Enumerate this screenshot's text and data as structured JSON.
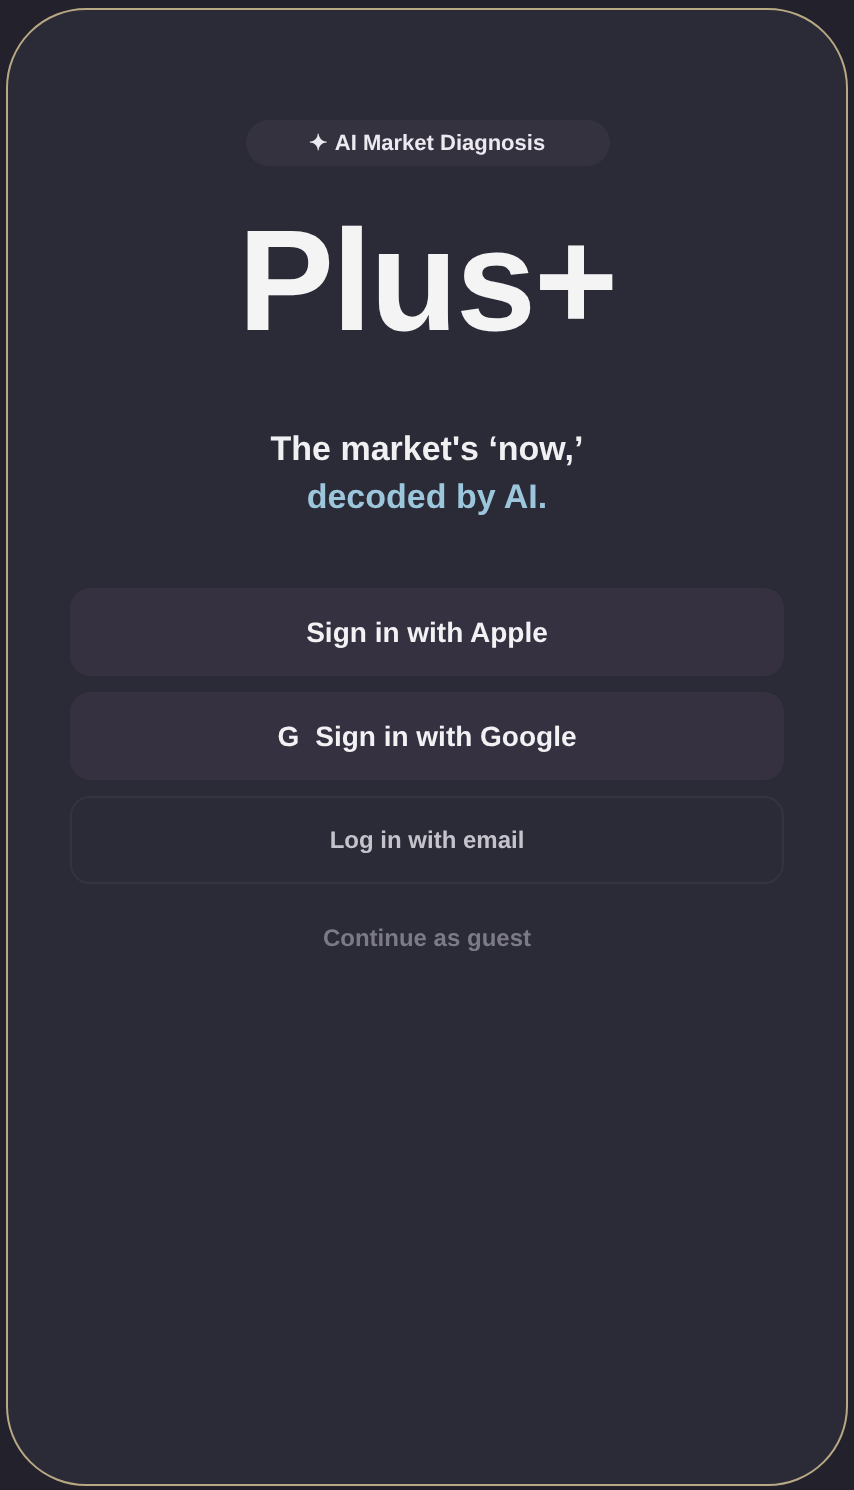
{
  "badge": {
    "icon": "✦",
    "label": "AI Market Diagnosis"
  },
  "title": "Plus+",
  "tagline": {
    "line_1": "The market's ‘now,’",
    "line_2": "decoded by AI."
  },
  "buttons": [
    {
      "kind": "filled",
      "label": "Sign in with Apple"
    },
    {
      "kind": "filled",
      "glyph": "G",
      "label": "Sign in with Google"
    },
    {
      "kind": "outline",
      "label": "Log in with email"
    },
    {
      "kind": "link",
      "label": "Continue as guest"
    }
  ]
}
